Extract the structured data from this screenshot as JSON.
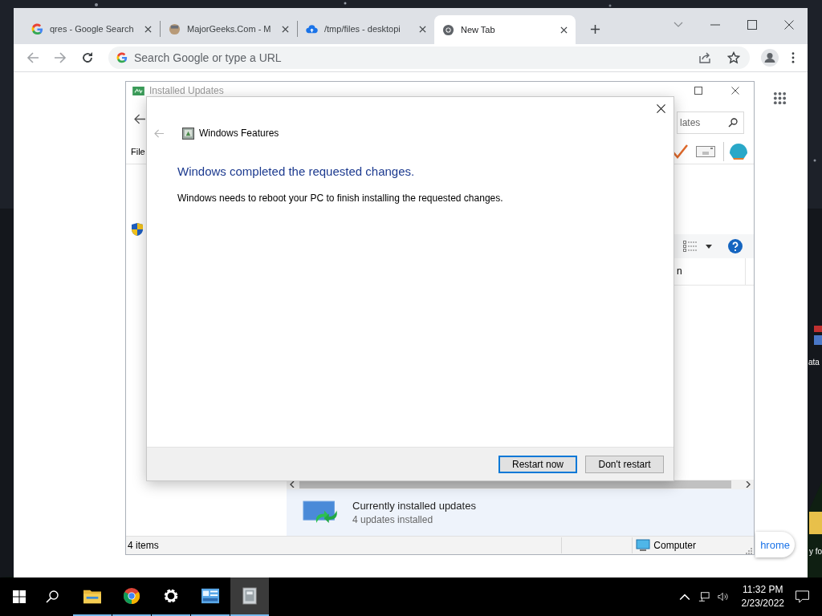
{
  "desktop": {
    "labels": [
      "ata",
      "y fo"
    ]
  },
  "browser": {
    "tabs": [
      {
        "title": "qres - Google Search",
        "kind": "google",
        "selected": false
      },
      {
        "title": "MajorGeeks.Com - M",
        "kind": "majorgeeks",
        "selected": false
      },
      {
        "title": "/tmp/files - desktopi",
        "kind": "cloud",
        "selected": false
      },
      {
        "title": "New Tab",
        "kind": "chrome",
        "selected": true
      }
    ],
    "omnibox": {
      "placeholder": "Search Google or type a URL"
    },
    "popup": {
      "text": "hrome"
    }
  },
  "installed_updates": {
    "title": "Installed Updates",
    "search": {
      "placeholder": "lates"
    },
    "menu": [
      "File"
    ],
    "column_header": "n",
    "details": {
      "title": "Currently installed updates",
      "subtitle": "4 updates installed"
    },
    "status_bar": {
      "count": "4 items",
      "location": "Computer"
    }
  },
  "dialog": {
    "title": "Windows Features",
    "heading": "Windows completed the requested changes.",
    "message": "Windows needs to reboot your PC to finish installing the requested changes.",
    "buttons": [
      {
        "label": "Restart now",
        "default": true
      },
      {
        "label": "Don't restart",
        "default": false
      }
    ]
  },
  "taskbar": {
    "apps": [
      {
        "kind": "folder",
        "selected": false
      },
      {
        "kind": "chrome",
        "selected": false
      },
      {
        "kind": "gear",
        "selected": false
      },
      {
        "kind": "control-panel",
        "selected": false
      },
      {
        "kind": "installer",
        "selected": true
      }
    ],
    "clock": {
      "time": "11:32 PM",
      "date": "2/23/2022"
    }
  }
}
